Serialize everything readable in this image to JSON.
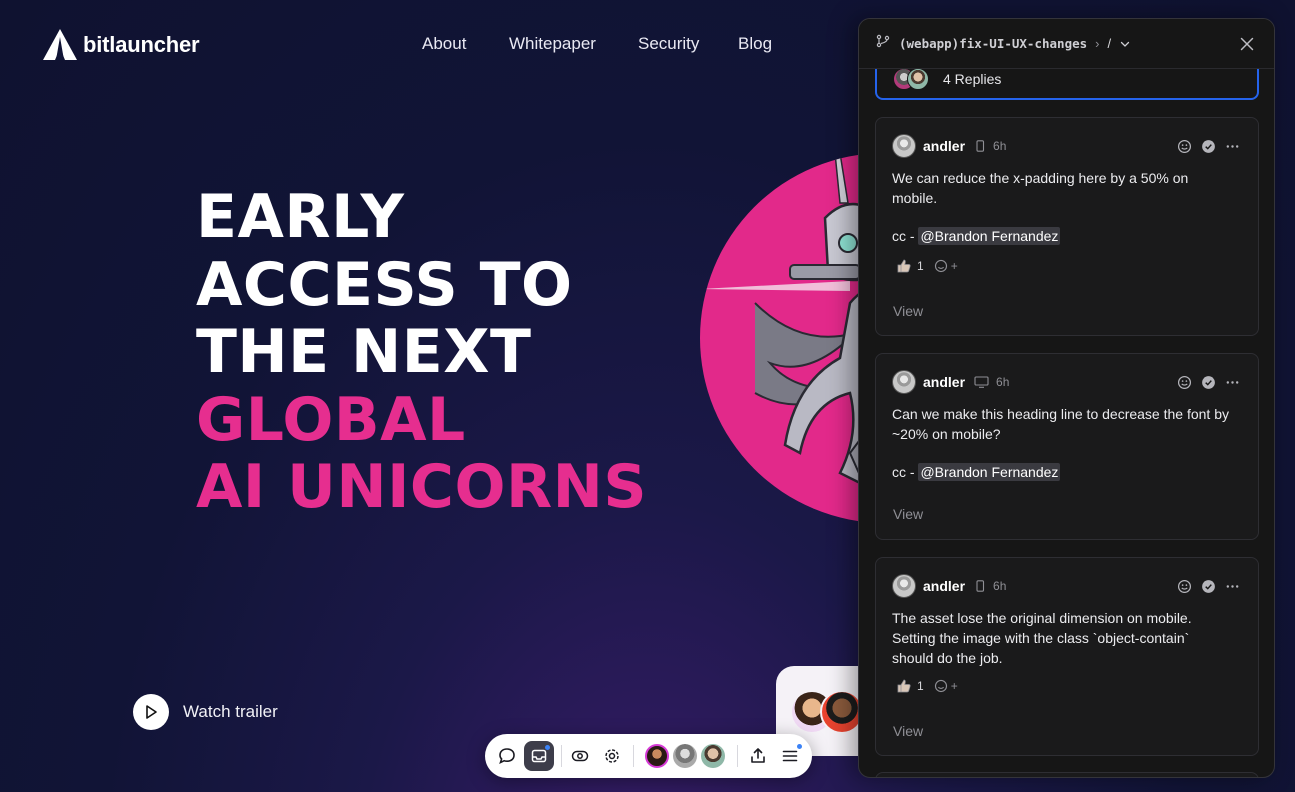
{
  "site": {
    "logo_text": "bitlauncher",
    "nav": [
      "About",
      "Whitepaper",
      "Security",
      "Blog"
    ]
  },
  "hero": {
    "lines": [
      {
        "text": "EARLY",
        "accent": false
      },
      {
        "text": "ACCESS TO",
        "accent": false
      },
      {
        "text": "THE NEXT",
        "accent": false
      },
      {
        "text": "GLOBAL",
        "accent": true
      },
      {
        "text": "AI UNICORNS",
        "accent": true
      }
    ],
    "watch_trailer": "Watch trailer"
  },
  "toolbar": {
    "buttons": [
      "comment-icon",
      "inbox-icon",
      "preview-eye-icon",
      "settings-gear-icon",
      "share-upload-icon",
      "menu-icon"
    ]
  },
  "panel": {
    "branch": "(webapp)fix-UI-UX-changes",
    "crumb_chevron": "›",
    "crumb_slash": "/",
    "replies_label": "4 Replies",
    "comments": [
      {
        "author": "andler",
        "device": "mobile",
        "time": "6h",
        "body": "We can reduce the x-padding here by a 50% on\nmobile.",
        "cc_prefix": "cc - ",
        "mention": "@Brandon Fernandez",
        "reaction_count": "1",
        "react_add": "+",
        "view": "View"
      },
      {
        "author": "andler",
        "device": "desktop",
        "time": "6h",
        "body": "Can we make this heading line to decrease the font by\n~20% on mobile?",
        "cc_prefix": "cc - ",
        "mention": "@Brandon Fernandez",
        "reaction_count": "",
        "react_add": "",
        "view": "View"
      },
      {
        "author": "andler",
        "device": "mobile",
        "time": "6h",
        "body": "The asset lose the original dimension on mobile.\nSetting the image with the class `object-contain`\nshould do the job.",
        "cc_prefix": "",
        "mention": "",
        "reaction_count": "1",
        "react_add": "+",
        "view": "View"
      }
    ]
  },
  "colors": {
    "accent_pink": "#e62e8f",
    "panel_bg": "#161616",
    "selection_blue": "#2563eb",
    "page_bg": "#111436"
  }
}
